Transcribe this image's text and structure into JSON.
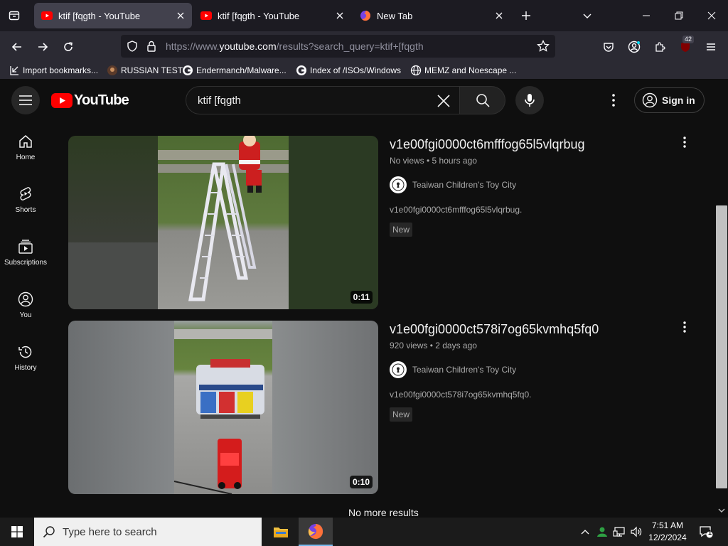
{
  "browser": {
    "tabs": [
      {
        "title": "ktif [fqgth - YouTube",
        "active": true
      },
      {
        "title": "ktif [fqgth - YouTube",
        "active": false
      },
      {
        "title": "New Tab",
        "active": false
      }
    ],
    "url_prefix": "https://www.",
    "url_host": "youtube.com",
    "url_rest": "/results?search_query=ktif+[fqgth",
    "extension_badge": "42",
    "bookmarks": [
      {
        "label": "Import bookmarks...",
        "icon": "import-icon"
      },
      {
        "label": "RUSSIAN TEST",
        "icon": "site-icon"
      },
      {
        "label": "Endermanch/Malware...",
        "icon": "github-icon"
      },
      {
        "label": "Index of /ISOs/Windows",
        "icon": "google-icon"
      },
      {
        "label": "MEMZ and Noescape ...",
        "icon": "globe-icon"
      }
    ]
  },
  "youtube": {
    "logo_text": "YouTube",
    "search_value": "ktif [fqgth",
    "sign_in": "Sign in",
    "guide": [
      {
        "label": "Home",
        "icon": "home-icon"
      },
      {
        "label": "Shorts",
        "icon": "shorts-icon"
      },
      {
        "label": "Subscriptions",
        "icon": "subscriptions-icon"
      },
      {
        "label": "You",
        "icon": "you-icon"
      },
      {
        "label": "History",
        "icon": "history-icon"
      }
    ],
    "results": [
      {
        "title": "v1e00fgi0000ct6mfffog65l5vlqrbug",
        "meta": "No views • 5 hours ago",
        "channel": "Teaiwan Children's Toy City",
        "description": "v1e00fgi0000ct6mfffog65l5vlqrbug.",
        "badge": "New",
        "duration": "0:11"
      },
      {
        "title": "v1e00fgi0000ct578i7og65kvmhq5fq0",
        "meta": "920 views • 2 days ago",
        "channel": "Teaiwan Children's Toy City",
        "description": "v1e00fgi0000ct578i7og65kvmhq5fq0.",
        "badge": "New",
        "duration": "0:10"
      }
    ],
    "end_text": "No more results"
  },
  "taskbar": {
    "search_placeholder": "Type here to search",
    "time": "7:51 AM",
    "date": "12/2/2024",
    "notification_count": "1"
  },
  "colors": {
    "yt_red": "#ff0000",
    "yt_bg": "#0f0f0f",
    "firefox_toolbar": "#2b2a33",
    "firefox_tabstrip": "#1c1b22"
  }
}
